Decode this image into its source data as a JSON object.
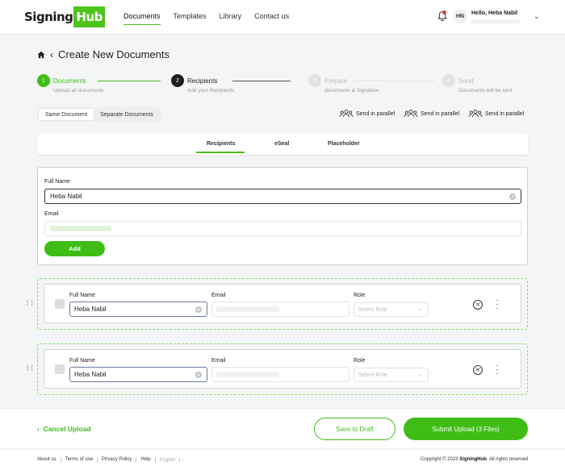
{
  "brand": {
    "logo_part1": "Signing",
    "logo_part2": "Hub",
    "accent": "#3fbd16"
  },
  "nav": {
    "items": [
      {
        "label": "Documents",
        "active": true
      },
      {
        "label": "Templates",
        "active": false
      },
      {
        "label": "Library",
        "active": false
      },
      {
        "label": "Contact us",
        "active": false
      }
    ]
  },
  "user": {
    "initials": "HN",
    "greeting": "Hello, Heba Nabil",
    "icons": [
      "bell-icon",
      "chevron-down-icon"
    ]
  },
  "page": {
    "title": "Create New Documents",
    "icons": [
      "home-icon",
      "back-icon"
    ]
  },
  "steps": [
    {
      "num": "1",
      "label": "Documents",
      "sub": "Upload all documents",
      "state": "done"
    },
    {
      "num": "2",
      "label": "Recipients",
      "sub": "Add your Recipients",
      "state": "current"
    },
    {
      "num": "3",
      "label": "Prepare",
      "sub": "documents & Signature",
      "state": "pending"
    },
    {
      "num": "4",
      "label": "Send",
      "sub": "Documents will be sent",
      "state": "pending"
    }
  ],
  "mode": {
    "options": [
      "Same Document",
      "Separate Documents"
    ],
    "selected": "Same Document"
  },
  "parallel": [
    "Send in parallel",
    "Send in parallel",
    "Send in parallel"
  ],
  "tabs": {
    "items": [
      "Recipients",
      "eSeal",
      "Placeholder"
    ],
    "active": "Recipients"
  },
  "form": {
    "full_name_label": "Full Name",
    "full_name_value": "Heba Nabil",
    "email_label": "Email",
    "add_label": "Add"
  },
  "recipients": [
    {
      "name_label": "Full Name",
      "name": "Heba Nabil",
      "email_label": "Email",
      "role_label": "Role",
      "role_placeholder": "Select Role"
    },
    {
      "name_label": "Full Name",
      "name": "Heba Nabil",
      "email_label": "Email",
      "role_label": "Role",
      "role_placeholder": "Select Role"
    }
  ],
  "actions": {
    "cancel": "Cancel Upload",
    "draft": "Save to Draft",
    "submit": "Submit Upload (3 Files)"
  },
  "footer": {
    "links": [
      "About us",
      "Terms of use",
      "Privacy Policy",
      "Help",
      "English"
    ],
    "copyright_prefix": "Copyright © 2023 ",
    "copyright_brand": "SigningHub",
    "copyright_suffix": ". All rights reserved"
  }
}
